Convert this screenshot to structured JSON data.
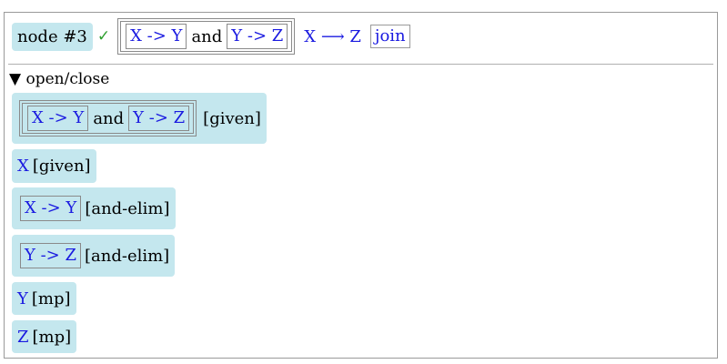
{
  "node": {
    "label": "node #3",
    "check": "✓",
    "premise": {
      "left": "X -> Y",
      "conj": "and",
      "right": "Y -> Z"
    },
    "conclusion": "X ⟶ Z",
    "join_label": "join"
  },
  "toggle": {
    "arrow": "▼",
    "label": "open/close"
  },
  "steps": [
    {
      "left": "X -> Y",
      "conj": "and",
      "right": "Y -> Z",
      "rule": "[given]"
    },
    {
      "text": "X",
      "rule": "[given]"
    },
    {
      "boxed": "X -> Y",
      "rule": "[and-elim]"
    },
    {
      "boxed": "Y -> Z",
      "rule": "[and-elim]"
    },
    {
      "text": "Y",
      "rule": "[mp]"
    },
    {
      "text": "Z",
      "rule": "[mp]"
    }
  ],
  "colors": {
    "highlight": "#c4e7ee",
    "formula": "#1a1ae0",
    "check": "#2e9f2e"
  }
}
